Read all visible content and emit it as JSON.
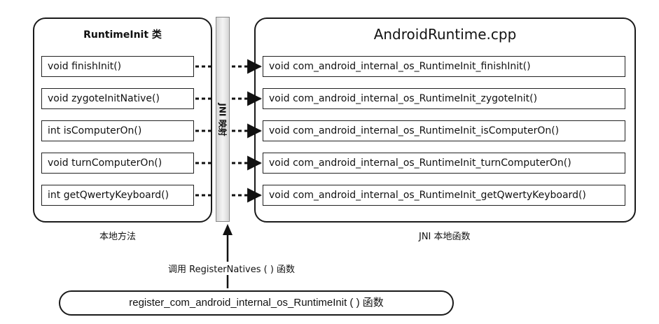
{
  "left_panel": {
    "title": "RuntimeInit 类",
    "methods": [
      "void finishInit()",
      "void zygoteInitNative()",
      "int isComputerOn()",
      "void turnComputerOn()",
      "int getQwertyKeyboard()"
    ],
    "caption": "本地方法"
  },
  "jni_bar": {
    "label": "JNI 映射"
  },
  "right_panel": {
    "title": "AndroidRuntime.cpp",
    "functions": [
      "void com_android_internal_os_RuntimeInit_finishInit()",
      "void com_android_internal_os_RuntimeInit_zygoteInit()",
      "void com_android_internal_os_RuntimeInit_isComputerOn()",
      "void com_android_internal_os_RuntimeInit_turnComputerOn()",
      "void com_android_internal_os_RuntimeInit_getQwertyKeyboard()"
    ],
    "caption": "JNI 本地函数"
  },
  "register_call": {
    "label": "调用 RegisterNatives ( ) 函数",
    "source": "register_com_android_internal_os_RuntimeInit ( ) 函数"
  }
}
